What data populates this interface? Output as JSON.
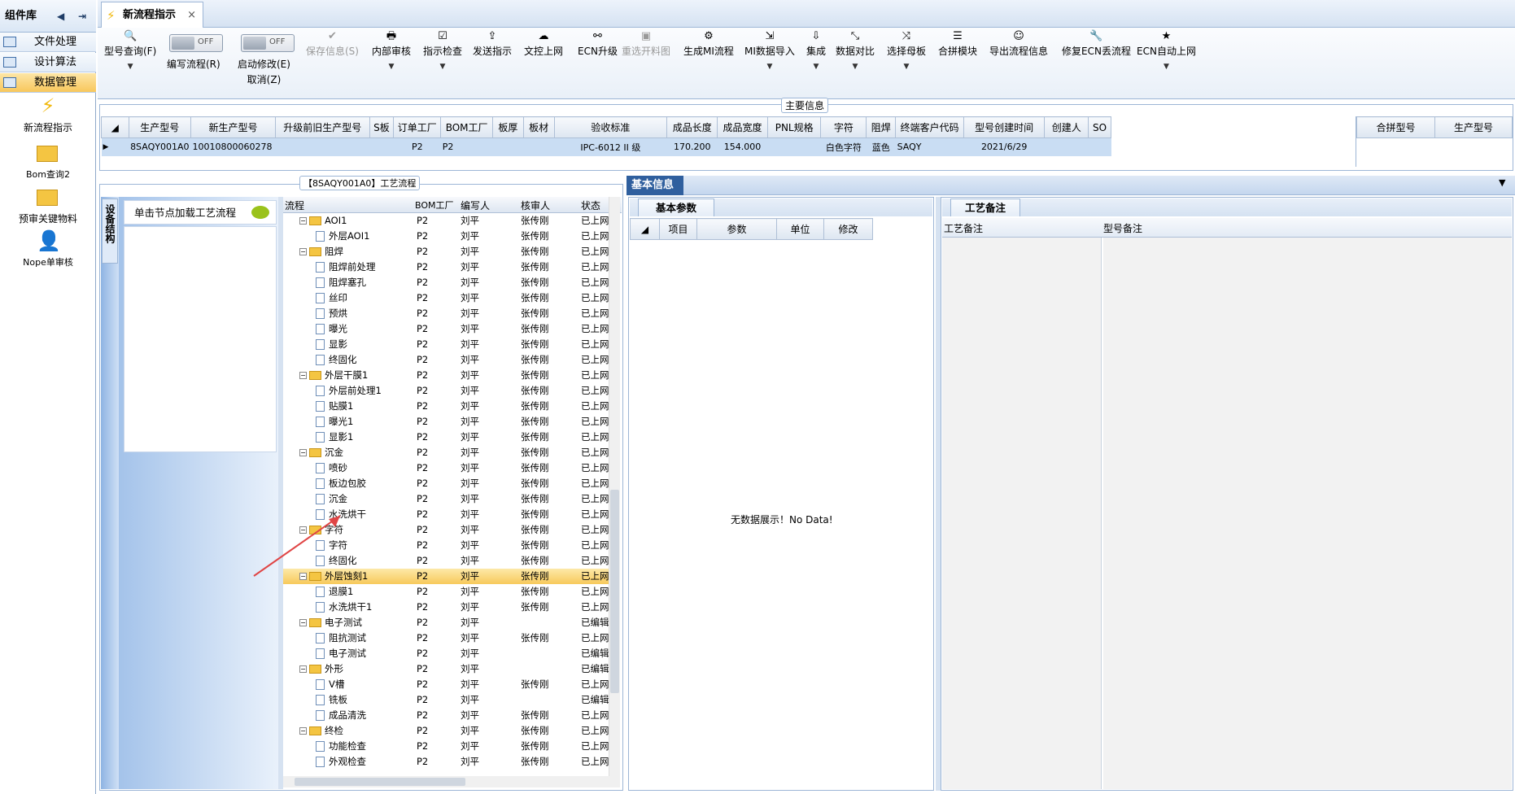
{
  "sidebar": {
    "title": "组件库",
    "items": [
      {
        "label": "文件处理"
      },
      {
        "label": "设计算法"
      },
      {
        "label": "数据管理"
      }
    ],
    "tools": [
      {
        "label": "新流程指示"
      },
      {
        "label": "Bom查询2"
      },
      {
        "label": "预审关键物料"
      },
      {
        "label": "Nope单审核"
      }
    ]
  },
  "tab": {
    "label": "新流程指示"
  },
  "ribbon": {
    "buttons": [
      {
        "label": "型号查询(F)"
      },
      {
        "label": "编写流程(R)"
      },
      {
        "label": "启动修改(E)"
      },
      {
        "label": "取消(Z)"
      },
      {
        "label": "保存信息(S)"
      },
      {
        "label": "内部审核"
      },
      {
        "label": "指示检查"
      },
      {
        "label": "发送指示"
      },
      {
        "label": "文控上网"
      },
      {
        "label": "ECN升级"
      },
      {
        "label": "重选开料图"
      },
      {
        "label": "生成MI流程"
      },
      {
        "label": "MI数据导入"
      },
      {
        "label": "集成"
      },
      {
        "label": "数据对比"
      },
      {
        "label": "选择母板"
      },
      {
        "label": "合拼模块"
      },
      {
        "label": "导出流程信息"
      },
      {
        "label": "修复ECN丢流程"
      },
      {
        "label": "ECN自动上网"
      }
    ],
    "toggle_off": "OFF"
  },
  "main_info": {
    "title": "主要信息",
    "columns": [
      "生产型号",
      "新生产型号",
      "升级前旧生产型号",
      "S板",
      "订单工厂",
      "BOM工厂",
      "板厚",
      "板材",
      "验收标准",
      "成品长度",
      "成品宽度",
      "PNL规格",
      "字符",
      "阻焊",
      "终端客户代码",
      "型号创建时间",
      "创建人",
      "SO"
    ],
    "row": {
      "prod": "8SAQY001A0",
      "new_prod": "10010800060278",
      "order_factory": "P2",
      "bom_factory": "P2",
      "standard": "IPC-6012 II 级",
      "length": "170.200",
      "width": "154.000",
      "char": "白色字符",
      "solder": "蓝色",
      "customer": "SAQY",
      "created": "2021/6/29"
    },
    "side_columns": [
      "合拼型号",
      "生产型号"
    ]
  },
  "process": {
    "title": "【8SAQY001A0】工艺流程",
    "side_tab": "设备结构",
    "hint": "单击节点加载工艺流程",
    "columns": [
      "流程",
      "BOM工厂",
      "编写人",
      "核审人",
      "状态"
    ],
    "rows": [
      {
        "n": "AOI1",
        "lvl": 0,
        "f": "P2",
        "w": "刘平",
        "r": "张传刚",
        "s": "已上网"
      },
      {
        "n": "外层AOI1",
        "lvl": 1,
        "f": "P2",
        "w": "刘平",
        "r": "张传刚",
        "s": "已上网"
      },
      {
        "n": "阻焊",
        "lvl": 0,
        "f": "P2",
        "w": "刘平",
        "r": "张传刚",
        "s": "已上网"
      },
      {
        "n": "阻焊前处理",
        "lvl": 1,
        "f": "P2",
        "w": "刘平",
        "r": "张传刚",
        "s": "已上网"
      },
      {
        "n": "阻焊塞孔",
        "lvl": 1,
        "f": "P2",
        "w": "刘平",
        "r": "张传刚",
        "s": "已上网"
      },
      {
        "n": "丝印",
        "lvl": 1,
        "f": "P2",
        "w": "刘平",
        "r": "张传刚",
        "s": "已上网"
      },
      {
        "n": "预烘",
        "lvl": 1,
        "f": "P2",
        "w": "刘平",
        "r": "张传刚",
        "s": "已上网"
      },
      {
        "n": "曝光",
        "lvl": 1,
        "f": "P2",
        "w": "刘平",
        "r": "张传刚",
        "s": "已上网"
      },
      {
        "n": "显影",
        "lvl": 1,
        "f": "P2",
        "w": "刘平",
        "r": "张传刚",
        "s": "已上网"
      },
      {
        "n": "终固化",
        "lvl": 1,
        "f": "P2",
        "w": "刘平",
        "r": "张传刚",
        "s": "已上网"
      },
      {
        "n": "外层干膜1",
        "lvl": 0,
        "f": "P2",
        "w": "刘平",
        "r": "张传刚",
        "s": "已上网"
      },
      {
        "n": "外层前处理1",
        "lvl": 1,
        "f": "P2",
        "w": "刘平",
        "r": "张传刚",
        "s": "已上网"
      },
      {
        "n": "贴膜1",
        "lvl": 1,
        "f": "P2",
        "w": "刘平",
        "r": "张传刚",
        "s": "已上网"
      },
      {
        "n": "曝光1",
        "lvl": 1,
        "f": "P2",
        "w": "刘平",
        "r": "张传刚",
        "s": "已上网"
      },
      {
        "n": "显影1",
        "lvl": 1,
        "f": "P2",
        "w": "刘平",
        "r": "张传刚",
        "s": "已上网"
      },
      {
        "n": "沉金",
        "lvl": 0,
        "f": "P2",
        "w": "刘平",
        "r": "张传刚",
        "s": "已上网"
      },
      {
        "n": "喷砂",
        "lvl": 1,
        "f": "P2",
        "w": "刘平",
        "r": "张传刚",
        "s": "已上网"
      },
      {
        "n": "板边包胶",
        "lvl": 1,
        "f": "P2",
        "w": "刘平",
        "r": "张传刚",
        "s": "已上网"
      },
      {
        "n": "沉金",
        "lvl": 1,
        "f": "P2",
        "w": "刘平",
        "r": "张传刚",
        "s": "已上网"
      },
      {
        "n": "水洗烘干",
        "lvl": 1,
        "f": "P2",
        "w": "刘平",
        "r": "张传刚",
        "s": "已上网"
      },
      {
        "n": "字符",
        "lvl": 0,
        "f": "P2",
        "w": "刘平",
        "r": "张传刚",
        "s": "已上网"
      },
      {
        "n": "字符",
        "lvl": 1,
        "f": "P2",
        "w": "刘平",
        "r": "张传刚",
        "s": "已上网"
      },
      {
        "n": "终固化",
        "lvl": 1,
        "f": "P2",
        "w": "刘平",
        "r": "张传刚",
        "s": "已上网"
      },
      {
        "n": "外层蚀刻1",
        "lvl": 0,
        "f": "P2",
        "w": "刘平",
        "r": "张传刚",
        "s": "已上网",
        "sel": true
      },
      {
        "n": "退膜1",
        "lvl": 1,
        "f": "P2",
        "w": "刘平",
        "r": "张传刚",
        "s": "已上网"
      },
      {
        "n": "水洗烘干1",
        "lvl": 1,
        "f": "P2",
        "w": "刘平",
        "r": "张传刚",
        "s": "已上网"
      },
      {
        "n": "电子测试",
        "lvl": 0,
        "f": "P2",
        "w": "刘平",
        "r": "",
        "s": "已编辑"
      },
      {
        "n": "阻抗测试",
        "lvl": 1,
        "f": "P2",
        "w": "刘平",
        "r": "张传刚",
        "s": "已上网"
      },
      {
        "n": "电子测试",
        "lvl": 1,
        "f": "P2",
        "w": "刘平",
        "r": "",
        "s": "已编辑"
      },
      {
        "n": "外形",
        "lvl": 0,
        "f": "P2",
        "w": "刘平",
        "r": "",
        "s": "已编辑"
      },
      {
        "n": "V槽",
        "lvl": 1,
        "f": "P2",
        "w": "刘平",
        "r": "张传刚",
        "s": "已上网"
      },
      {
        "n": "铣板",
        "lvl": 1,
        "f": "P2",
        "w": "刘平",
        "r": "",
        "s": "已编辑"
      },
      {
        "n": "成品清洗",
        "lvl": 1,
        "f": "P2",
        "w": "刘平",
        "r": "张传刚",
        "s": "已上网"
      },
      {
        "n": "终检",
        "lvl": 0,
        "f": "P2",
        "w": "刘平",
        "r": "张传刚",
        "s": "已上网"
      },
      {
        "n": "功能检查",
        "lvl": 1,
        "f": "P2",
        "w": "刘平",
        "r": "张传刚",
        "s": "已上网"
      },
      {
        "n": "外观检查",
        "lvl": 1,
        "f": "P2",
        "w": "刘平",
        "r": "张传刚",
        "s": "已上网"
      }
    ]
  },
  "basic_info": {
    "title": "基本信息",
    "tab": "基本参数",
    "columns": [
      "项目",
      "参数",
      "单位",
      "修改"
    ],
    "empty": "无数据展示！No Data!"
  },
  "craft": {
    "tab": "工艺备注",
    "col1": "工艺备注",
    "col2": "型号备注"
  }
}
